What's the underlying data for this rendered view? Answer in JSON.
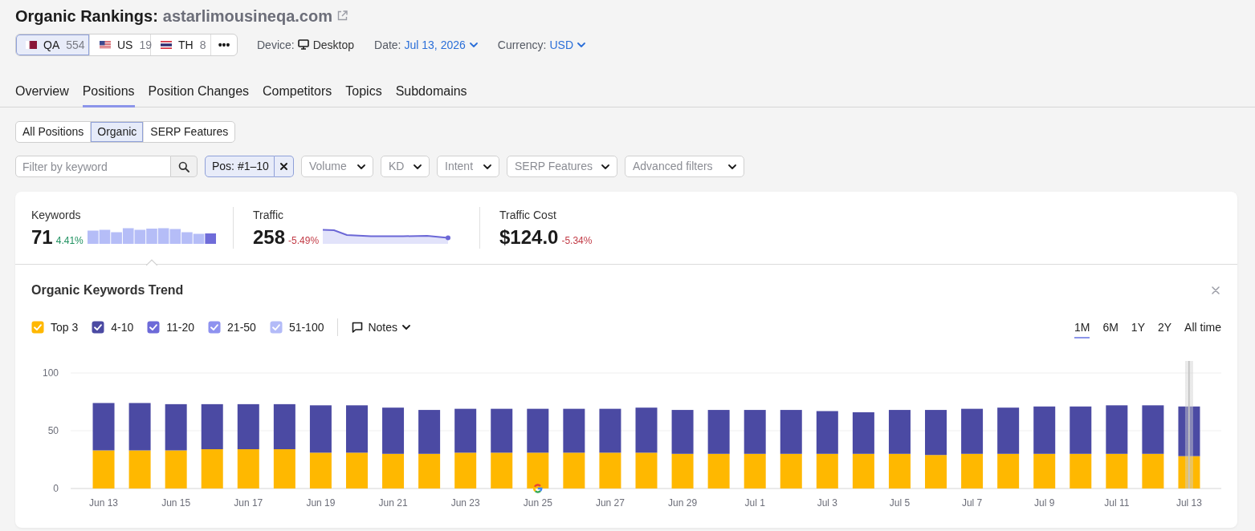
{
  "header": {
    "title": "Organic Rankings:",
    "domain": "astarlimousineqa.com"
  },
  "databases": [
    {
      "kind": "qatar",
      "code": "QA",
      "count": "554",
      "selected": true
    },
    {
      "kind": "usa",
      "code": "US",
      "count": "19",
      "selected": false
    },
    {
      "kind": "thailand",
      "code": "TH",
      "count": "8",
      "selected": false
    }
  ],
  "more_label": "•••",
  "settings": [
    {
      "kind": "device",
      "label": "Device:",
      "value": "Desktop"
    },
    {
      "kind": "dropdown",
      "label": "Date:",
      "value": "Jul 13, 2026"
    },
    {
      "kind": "dropdown",
      "label": "Currency:",
      "value": "USD"
    }
  ],
  "tabs": [
    {
      "label": "Overview",
      "selected": false
    },
    {
      "label": "Positions",
      "selected": true
    },
    {
      "label": "Position Changes",
      "selected": false
    },
    {
      "label": "Competitors",
      "selected": false
    },
    {
      "label": "Topics",
      "selected": false
    },
    {
      "label": "Subdomains",
      "selected": false
    }
  ],
  "position_types": [
    {
      "label": "All Positions",
      "selected": false
    },
    {
      "label": "Organic",
      "selected": true
    },
    {
      "label": "SERP Features",
      "selected": false
    }
  ],
  "filters": {
    "keyword_placeholder": "Filter by keyword",
    "active": [
      {
        "label": "Pos: #1–10"
      }
    ],
    "dropdowns": [
      "Volume",
      "KD",
      "Intent",
      "SERP Features",
      "Advanced filters"
    ]
  },
  "metrics": [
    {
      "kind": "bars",
      "label": "Keywords",
      "value": "71",
      "change": "4.41%",
      "color": "#1f9160",
      "selected": true
    },
    {
      "kind": "area",
      "label": "Traffic",
      "value": "258",
      "change": "-5.49%",
      "color": "#c23b46",
      "selected": false
    },
    {
      "kind": "none",
      "label": "Traffic Cost",
      "value": "$124.0",
      "change": "-5.34%",
      "color": "#c23b46",
      "selected": false
    }
  ],
  "chart_panel": {
    "title": "Organic Keywords Trend",
    "legend": [
      {
        "label": "Top 3",
        "checked": true,
        "color": "#ffb800"
      },
      {
        "label": "4-10",
        "checked": true,
        "color": "#4b4aa3"
      },
      {
        "label": "11-20",
        "checked": true,
        "color": "#6d6ad8"
      },
      {
        "label": "21-50",
        "checked": true,
        "color": "#8e92ef"
      },
      {
        "label": "51-100",
        "checked": true,
        "color": "#b3bbf8"
      }
    ],
    "notes_label": "Notes",
    "periods": [
      {
        "label": "1M",
        "selected": true
      },
      {
        "label": "6M",
        "selected": false
      },
      {
        "label": "1Y",
        "selected": false
      },
      {
        "label": "2Y",
        "selected": false
      },
      {
        "label": "All time",
        "selected": false
      }
    ],
    "chart_data": {
      "type": "bar",
      "stacked": true,
      "categories": [
        "Jun 13",
        null,
        "Jun 15",
        null,
        "Jun 17",
        null,
        "Jun 19",
        null,
        "Jun 21",
        null,
        "Jun 23",
        null,
        "Jun 25",
        null,
        "Jun 27",
        null,
        "Jun 29",
        null,
        "Jul 1",
        null,
        "Jul 3",
        null,
        "Jul 5",
        null,
        "Jul 7",
        null,
        "Jul 9",
        null,
        "Jul 11",
        null,
        "Jul 13"
      ],
      "ylim": [
        0,
        100
      ],
      "yticks": [
        0,
        50,
        100
      ],
      "series": [
        {
          "color": "#ffb800",
          "values": [
            33,
            33,
            33,
            34,
            34,
            34,
            31,
            31,
            30,
            30,
            31,
            31,
            31,
            31,
            31,
            31,
            30,
            30,
            30,
            30,
            30,
            30,
            30,
            29,
            30,
            30,
            30,
            30,
            30,
            30,
            28
          ]
        },
        {
          "color": "#4b4aa3",
          "values": [
            41,
            41,
            40,
            39,
            39,
            39,
            41,
            41,
            40,
            38,
            38,
            38,
            38,
            38,
            38,
            39,
            38,
            38,
            38,
            38,
            37,
            36,
            38,
            39,
            39,
            40,
            41,
            41,
            42,
            42,
            43
          ]
        }
      ],
      "annotations": [
        {
          "x": "Jun 25"
        }
      ],
      "ref_lines": [
        {
          "axis": "x",
          "value": "Jul 13"
        }
      ]
    }
  }
}
